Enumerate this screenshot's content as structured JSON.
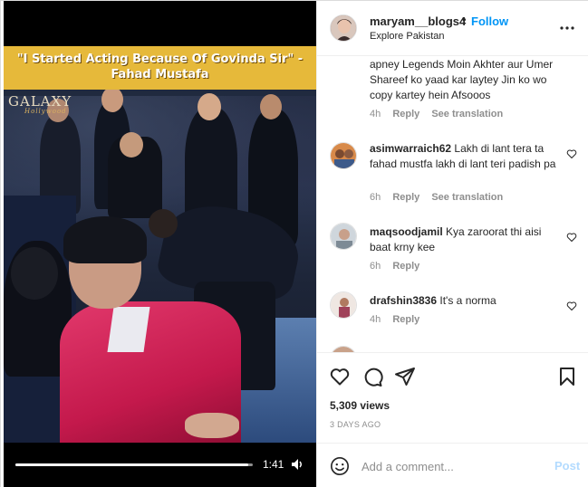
{
  "video": {
    "headline": "\"I Started Acting Because Of Govinda Sir\" - Fahad Mustafa",
    "brand_logo": "GALAXY",
    "brand_logo_sub": "Hollywood",
    "time": "1:41",
    "progress_fraction": 0.98
  },
  "post_header": {
    "username": "maryam__blogs4",
    "dot": "•",
    "follow_label": "Follow",
    "location": "Explore Pakistan"
  },
  "comments": [
    {
      "username": "",
      "text": "apney Legends Moin Akhter aur Umer Shareef ko yaad kar laytey Jin ko wo copy kartey hein Afsooos",
      "time": "4h",
      "reply": "Reply",
      "translate": "See translation"
    },
    {
      "username": "asimwarraich62",
      "text": "Lakh di lant tera ta fahad mustfa lakh di lant teri padish pa",
      "time": "6h",
      "reply": "Reply",
      "translate": "See translation"
    },
    {
      "username": "maqsoodjamil",
      "text": "Kya zaroorat thi aisi baat krny kee",
      "time": "6h",
      "reply": "Reply"
    },
    {
      "username": "drafshin3836",
      "text": "It's a norma",
      "time": "4h",
      "reply": "Reply"
    }
  ],
  "actions": {
    "views": "5,309 views",
    "date": "3 DAYS AGO"
  },
  "comment_box": {
    "placeholder": "Add a comment...",
    "post_label": "Post"
  },
  "colors": {
    "accent": "#0095f6",
    "post_disabled": "#b3dbff",
    "muted": "#8e8e8e",
    "headline_band": "#e6b93a"
  }
}
